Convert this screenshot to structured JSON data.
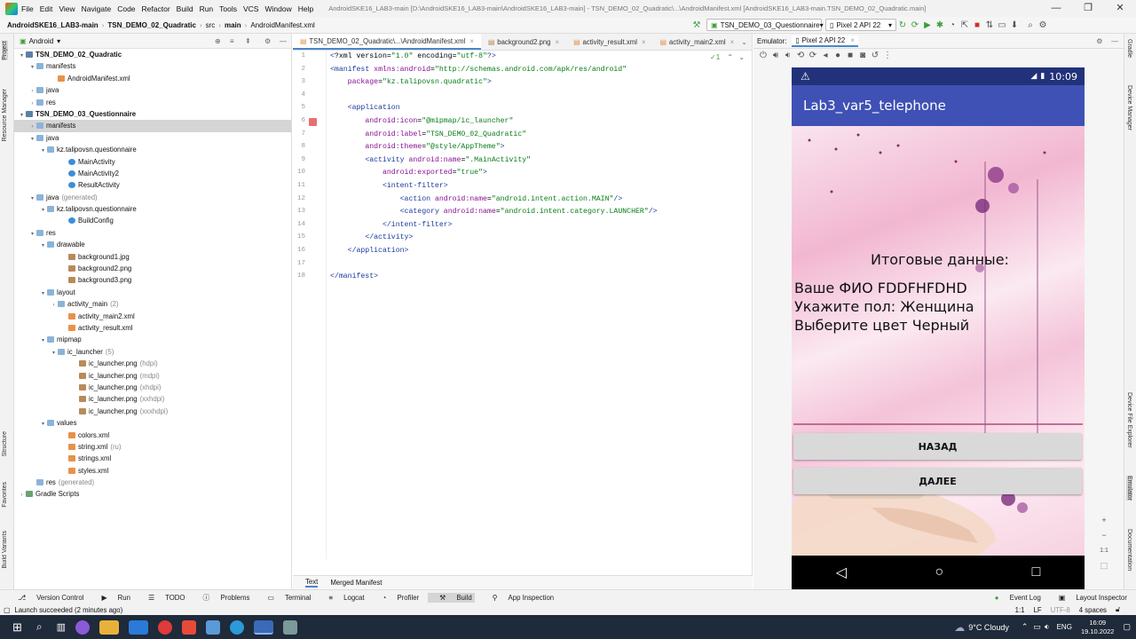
{
  "titlebar": {
    "menu": [
      "File",
      "Edit",
      "View",
      "Navigate",
      "Code",
      "Refactor",
      "Build",
      "Run",
      "Tools",
      "VCS",
      "Window",
      "Help"
    ],
    "window_title": "AndroidSKE16_LAB3-main [D:\\AndroidSKE16_LAB3-main\\AndroidSKE16_LAB3-main] - TSN_DEMO_02_Quadratic\\...\\AndroidManifest.xml [AndroidSKE16_LAB3-main.TSN_DEMO_02_Quadratic.main]"
  },
  "navbar": {
    "crumbs": [
      "AndroidSKE16_LAB3-main",
      "TSN_DEMO_02_Quadratic",
      "src",
      "main",
      "AndroidManifest.xml"
    ],
    "run_config": "TSN_DEMO_03_Questionnaire",
    "device": "Pixel 2 API 22"
  },
  "leftstrip": {
    "labels": [
      "Project",
      "Resource Manager",
      "Structure",
      "Favorites",
      "Build Variants"
    ]
  },
  "rightstrip": {
    "labels": [
      "Gradle",
      "Device Manager",
      "Device File Explorer",
      "Emulator",
      "Documentation"
    ]
  },
  "project": {
    "view": "Android",
    "tree": [
      {
        "text": "TSN_DEMO_02_Quadratic",
        "bold": true
      },
      {
        "text": "manifests"
      },
      {
        "text": "AndroidManifest.xml"
      },
      {
        "text": "java"
      },
      {
        "text": "res"
      },
      {
        "text": "TSN_DEMO_03_Questionnaire",
        "bold": true
      },
      {
        "text": "manifests"
      },
      {
        "text": "java"
      },
      {
        "text": "kz.talipovsn.questionnaire"
      },
      {
        "text": "MainActivity"
      },
      {
        "text": "MainActivity2"
      },
      {
        "text": "ResultActivity"
      },
      {
        "text": "java",
        "note": "(generated)"
      },
      {
        "text": "kz.talipovsn.questionnaire"
      },
      {
        "text": "BuildConfig"
      },
      {
        "text": "res"
      },
      {
        "text": "drawable"
      },
      {
        "text": "background1.jpg"
      },
      {
        "text": "background2.png"
      },
      {
        "text": "background3.png"
      },
      {
        "text": "layout"
      },
      {
        "text": "activity_main",
        "note": "(2)"
      },
      {
        "text": "activity_main2.xml"
      },
      {
        "text": "activity_result.xml"
      },
      {
        "text": "mipmap"
      },
      {
        "text": "ic_launcher",
        "note": "(5)"
      },
      {
        "text": "ic_launcher.png",
        "note": "(hdpi)"
      },
      {
        "text": "ic_launcher.png",
        "note": "(mdpi)"
      },
      {
        "text": "ic_launcher.png",
        "note": "(xhdpi)"
      },
      {
        "text": "ic_launcher.png",
        "note": "(xxhdpi)"
      },
      {
        "text": "ic_launcher.png",
        "note": "(xxxhdpi)"
      },
      {
        "text": "values"
      },
      {
        "text": "colors.xml"
      },
      {
        "text": "string.xml",
        "note": "(ru)"
      },
      {
        "text": "strings.xml"
      },
      {
        "text": "styles.xml"
      },
      {
        "text": "res",
        "note": "(generated)"
      },
      {
        "text": "Gradle Scripts"
      }
    ]
  },
  "editor": {
    "tabs": [
      "TSN_DEMO_02_Quadratic\\...\\AndroidManifest.xml",
      "background2.png",
      "activity_result.xml",
      "activity_main2.xml"
    ],
    "inspection": "✓1",
    "lines": [
      "<?xml version=\"1.0\" encoding=\"utf-8\"?>",
      "<manifest xmlns:android=\"http://schemas.android.com/apk/res/android\"",
      "    package=\"kz.talipovsn.quadratic\">",
      "",
      "    <application",
      "        android:icon=\"@mipmap/ic_launcher\"",
      "        android:label=\"TSN_DEMO_02_Quadratic\"",
      "        android:theme=\"@style/AppTheme\">",
      "        <activity android:name=\".MainActivity\"",
      "            android:exported=\"true\">",
      "            <intent-filter>",
      "                <action android:name=\"android.intent.action.MAIN\"/>",
      "                <category android:name=\"android.intent.category.LAUNCHER\"/>",
      "            </intent-filter>",
      "        </activity>",
      "    </application>",
      "",
      "</manifest>"
    ],
    "bottom_tabs": [
      "Text",
      "Merged Manifest"
    ]
  },
  "emulator": {
    "label": "Emulator:",
    "device_tab": "Pixel 2 API 22",
    "time": "10:09",
    "app_title": "Lab3_var5_telephone",
    "heading": "Итоговые данные:",
    "result_lines": [
      "Ваше ФИО FDDFHFDHD",
      "Укажите пол: Женщина",
      "Выберите цвет Черный"
    ],
    "btn_back": "НАЗАД",
    "btn_next": "ДАЛЕЕ",
    "zoom_label": "1:1"
  },
  "bottomtools": [
    "Version Control",
    "Run",
    "TODO",
    "Problems",
    "Terminal",
    "Logcat",
    "Profiler",
    "Build",
    "App Inspection",
    "Event Log",
    "Layout Inspector"
  ],
  "statusbar": {
    "message": "Launch succeeded (2 minutes ago)",
    "position": "1:1",
    "line_sep": "LF",
    "encoding": "UTF-8",
    "indent": "4 spaces"
  },
  "taskbar": {
    "weather": "9°C  Cloudy",
    "lang": "ENG",
    "time": "16:09",
    "date": "19.10.2022"
  },
  "colors": {
    "accent": "#3f51b5",
    "status": "#22327a",
    "selection": "#d5d5d5"
  }
}
